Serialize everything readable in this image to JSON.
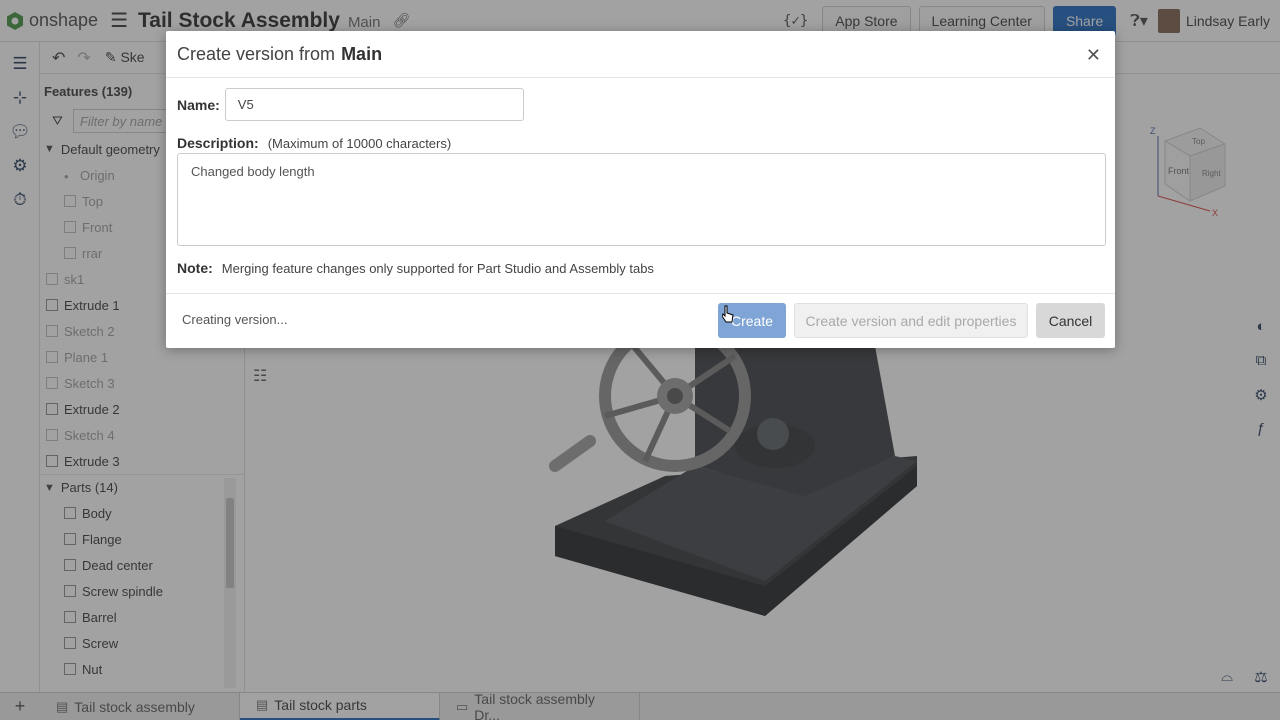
{
  "app": {
    "brand": "onshape",
    "document_title": "Tail Stock Assembly",
    "branch": "Main"
  },
  "topbar": {
    "app_store": "App Store",
    "learning_center": "Learning Center",
    "share": "Share",
    "user_name": "Lindsay Early",
    "accent_color": "#1560bd"
  },
  "toolbar": {
    "sketch_label": "Ske"
  },
  "features": {
    "header": "Features (139)",
    "filter_placeholder": "Filter by name",
    "default_geometry": "Default geometry",
    "items": [
      {
        "label": "Origin",
        "muted": true
      },
      {
        "label": "Top",
        "muted": true
      },
      {
        "label": "Front",
        "muted": true
      },
      {
        "label": "rrar",
        "muted": true
      },
      {
        "label": "sk1",
        "muted": true
      },
      {
        "label": "Extrude 1",
        "muted": false
      },
      {
        "label": "Sketch 2",
        "muted": true
      },
      {
        "label": "Plane 1",
        "muted": true
      },
      {
        "label": "Sketch 3",
        "muted": true
      },
      {
        "label": "Extrude 2",
        "muted": false
      },
      {
        "label": "Sketch 4",
        "muted": true
      },
      {
        "label": "Extrude 3",
        "muted": false
      }
    ],
    "parts_header": "Parts (14)",
    "parts": [
      "Body",
      "Flange",
      "Dead center",
      "Screw spindle",
      "Barrel",
      "Screw",
      "Nut"
    ]
  },
  "tabs": [
    {
      "label": "Tail stock assembly",
      "active": false
    },
    {
      "label": "Tail stock parts",
      "active": true
    },
    {
      "label": "Tail stock assembly Dr...",
      "active": false
    }
  ],
  "dialog": {
    "title": "Create version from",
    "title_branch": "Main",
    "name_label": "Name:",
    "name_value": "V5",
    "description_label": "Description:",
    "description_hint": "(Maximum of 10000 characters)",
    "description_value": "Changed body length",
    "note_label": "Note:",
    "note_text": "Merging feature changes only supported for Part Studio and Assembly tabs",
    "status": "Creating version...",
    "create_button": "Create",
    "create_edit_button": "Create version and edit properties",
    "cancel_button": "Cancel"
  },
  "viewcube": {
    "top": "Top",
    "front": "Front",
    "right": "Right",
    "z_axis": "Z",
    "x_axis": "X"
  }
}
